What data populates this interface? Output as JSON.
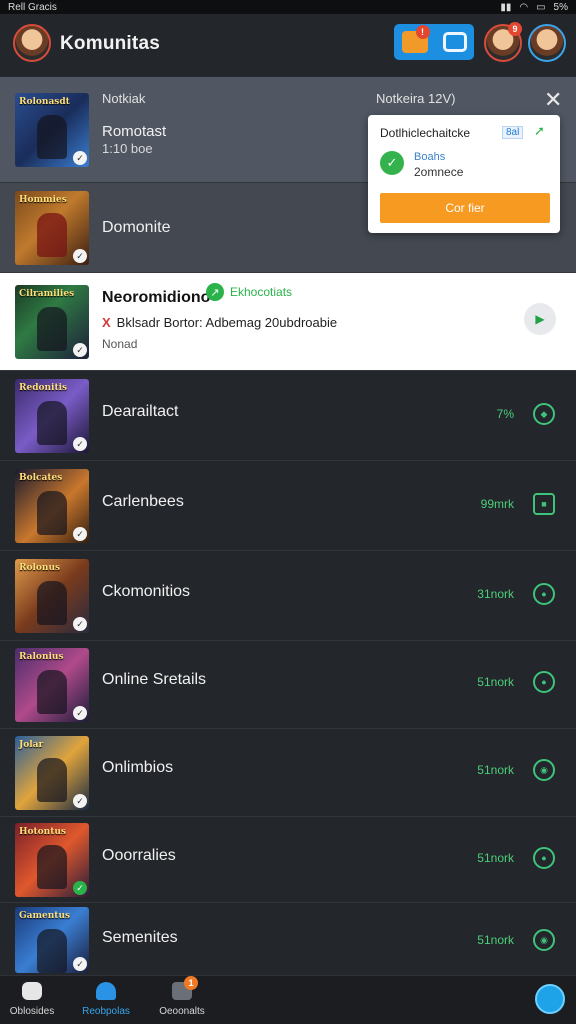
{
  "status_bar": {
    "left": "Rell Gracis",
    "right_icons": [
      "signal-icon",
      "wifi-icon",
      "battery-icon"
    ],
    "battery": "5%"
  },
  "header": {
    "title": "Komunitas",
    "badge_a": "!",
    "badge_avatar": "9"
  },
  "top_row": {
    "label_left": "Notkiak",
    "label_right": "Notkeira 12V)",
    "title": "Romotast",
    "subtitle": "1:10 boe"
  },
  "popup": {
    "title": "Dotlhiclechaitcke",
    "chip": "8al",
    "line1": "Boahs",
    "line2": "2omnece",
    "button": "Cor fier"
  },
  "second_row": {
    "title": "Domonite"
  },
  "highlight_row": {
    "title": "Neoromidiono",
    "tag": "Ekhocotiats",
    "desc_mark": "X",
    "desc": "Bklsadr Bortor: Adbemag 20ubdroabie",
    "sub": "Nonad"
  },
  "rows": [
    {
      "title": "Dearailtact",
      "meta": "7%"
    },
    {
      "title": "Carlenbees",
      "meta": "99mrk"
    },
    {
      "title": "Ckomonitios",
      "meta": "31nork"
    },
    {
      "title": "Online Sretails",
      "meta": "51nork"
    },
    {
      "title": "Onlimbios",
      "meta": "51nork"
    },
    {
      "title": "Ooorralies",
      "meta": "51nork"
    },
    {
      "title": "Semenites",
      "meta": "51nork"
    }
  ],
  "thumb_titles": [
    "Rolonasdt",
    "Hommies",
    "Cilramilies",
    "Redonitis",
    "Bolcates",
    "Rolonus",
    "Ralonius",
    "Jolar",
    "Hotontus",
    "Gamentus"
  ],
  "bottom_nav": {
    "items": [
      {
        "label": "Oblosides"
      },
      {
        "label": "Reobpolas"
      },
      {
        "label": "Oeoonalts"
      }
    ],
    "badge": "1"
  },
  "colors": {
    "accent": "#1c8fe0",
    "green": "#3fc37b",
    "orange": "#f79a22"
  }
}
